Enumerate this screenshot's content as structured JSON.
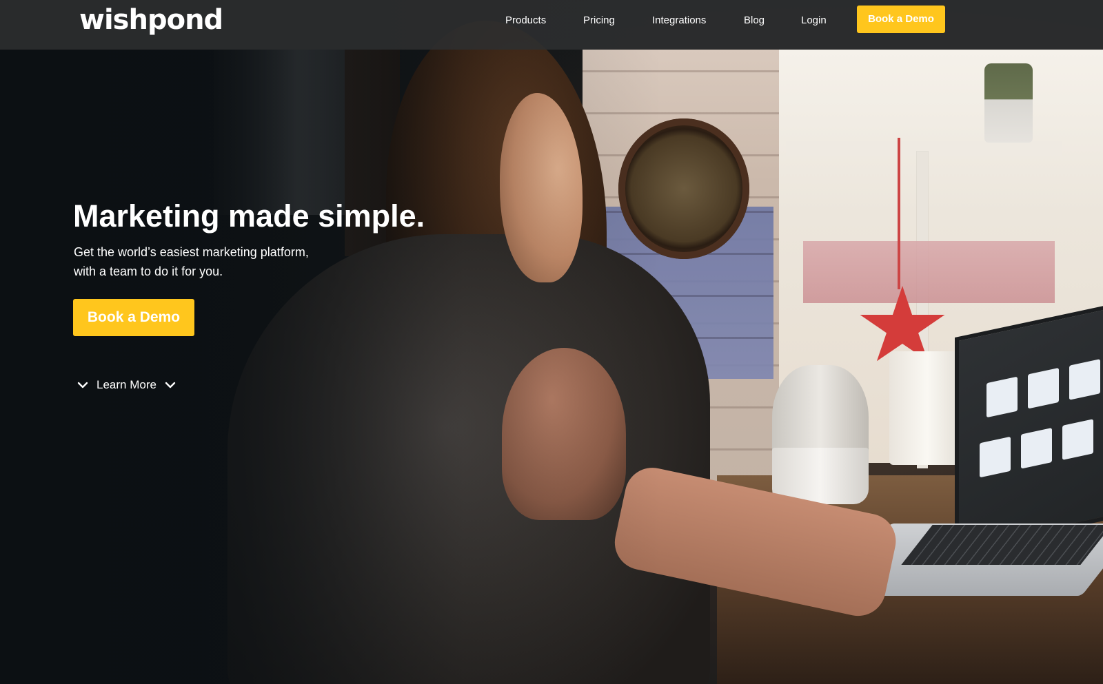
{
  "nav": {
    "logo": "wishpond",
    "links": [
      "Products",
      "Pricing",
      "Integrations",
      "Blog",
      "Login"
    ],
    "cta_label": "Book a Demo"
  },
  "hero": {
    "title": "Marketing made simple.",
    "subtitle_line1": "Get the world’s easiest marketing platform,",
    "subtitle_line2": "with a team to do it for you.",
    "cta_label": "Book a Demo",
    "learn_more_label": "Learn More"
  },
  "colors": {
    "accent": "#ffc61d",
    "nav_bg": "#2d2f30",
    "text": "#ffffff"
  },
  "icons": {
    "learn_more_left": "chevron-down-icon",
    "learn_more_right": "chevron-down-icon"
  }
}
